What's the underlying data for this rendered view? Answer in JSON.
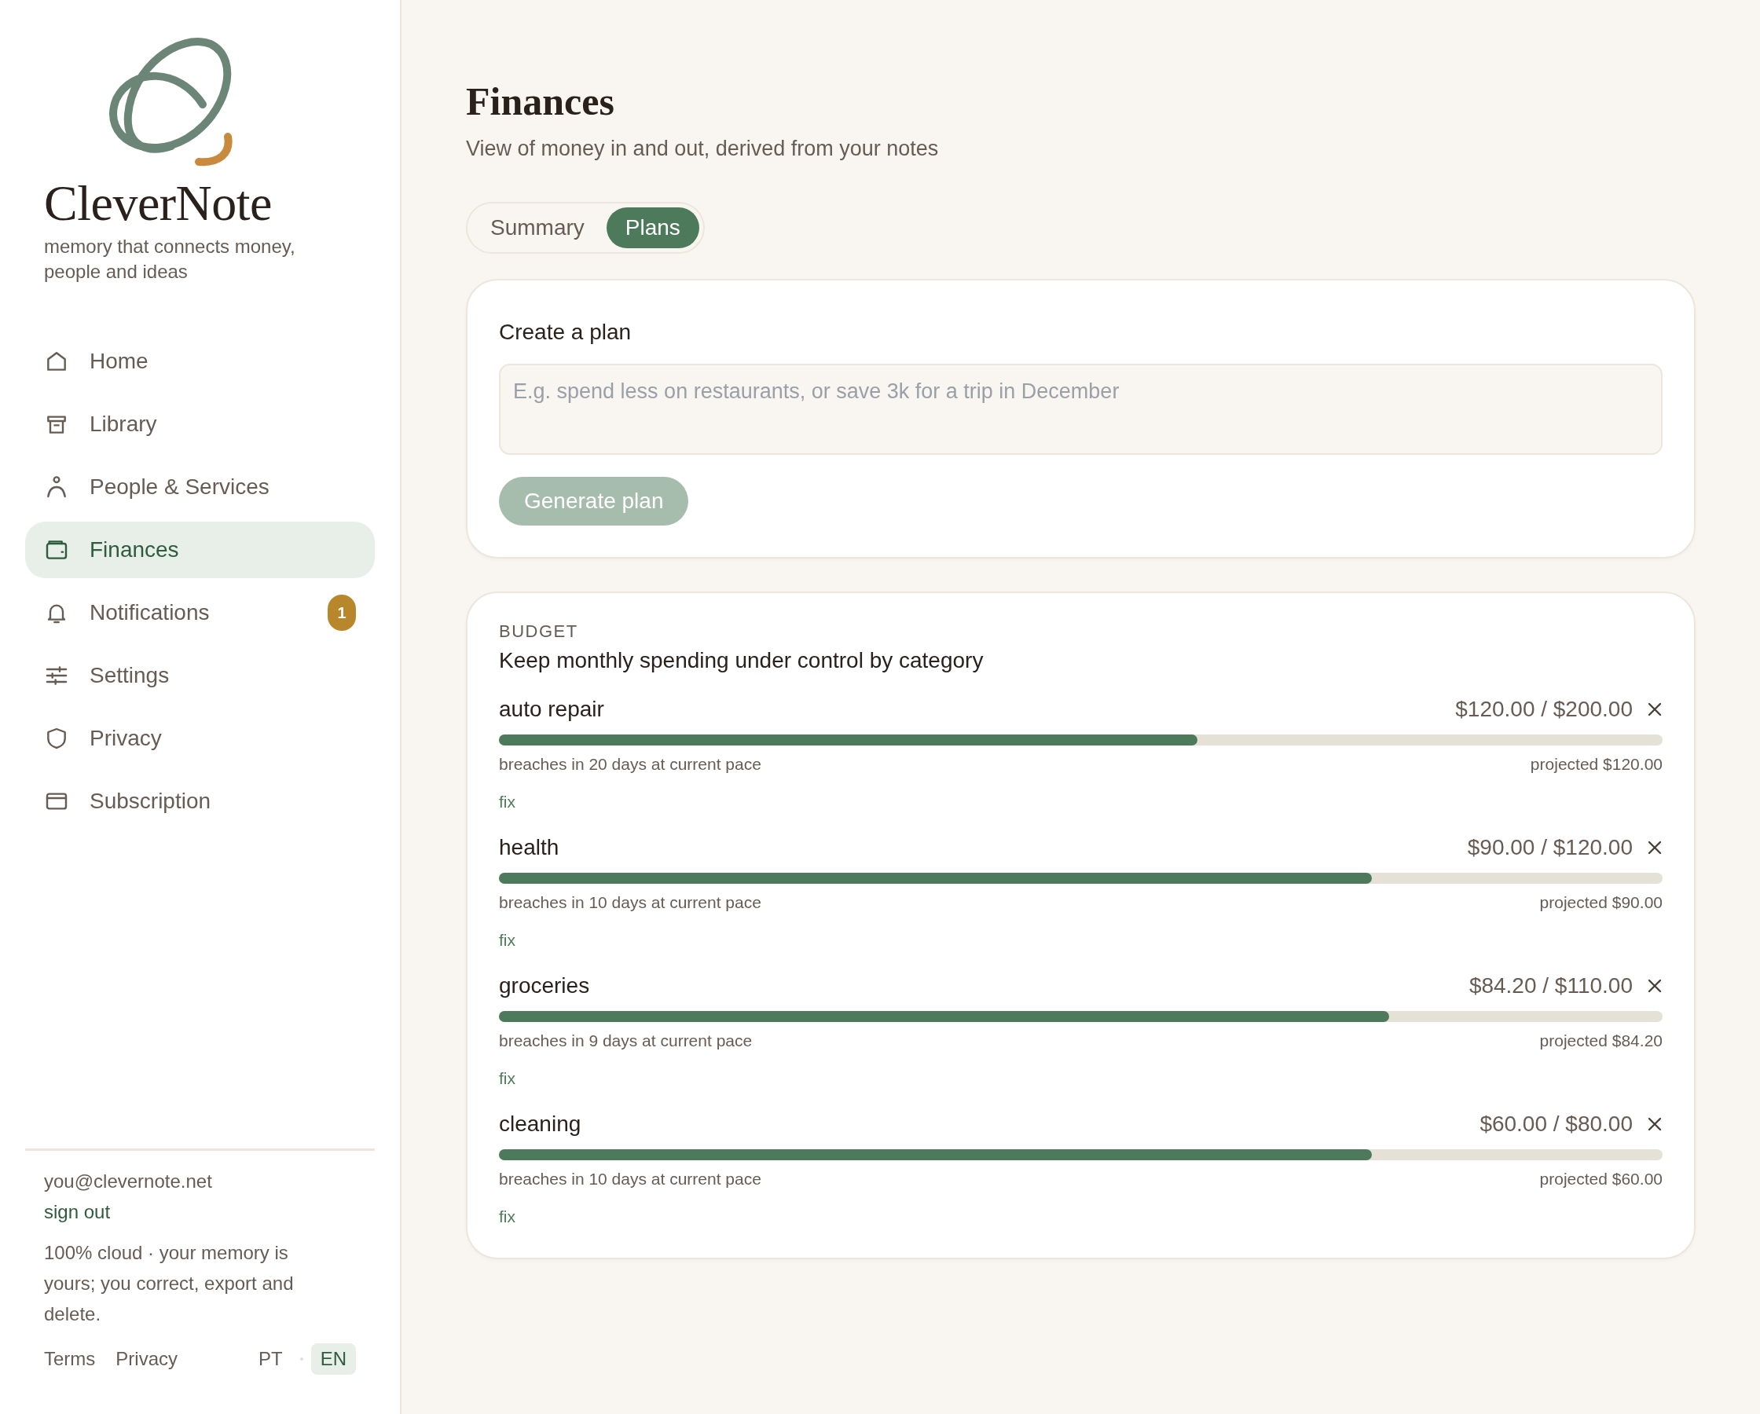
{
  "sidebar": {
    "brand": "CleverNote",
    "tagline": "memory that connects money, people and ideas",
    "items": [
      {
        "label": "Home",
        "kind": "home",
        "selected": false
      },
      {
        "label": "Library",
        "kind": "archive",
        "selected": false
      },
      {
        "label": "People & Services",
        "kind": "person",
        "selected": false
      },
      {
        "label": "Finances",
        "kind": "wallet",
        "selected": true
      },
      {
        "label": "Notifications",
        "kind": "bell",
        "selected": false,
        "badge": "1"
      },
      {
        "label": "Settings",
        "kind": "sliders",
        "selected": false
      },
      {
        "label": "Privacy",
        "kind": "shield",
        "selected": false
      },
      {
        "label": "Subscription",
        "kind": "card",
        "selected": false
      }
    ],
    "email": "you@clevernote.net",
    "sign_out": "sign out",
    "note": "100% cloud · your memory is yours; you correct, export and delete.",
    "links": [
      "Terms",
      "Privacy"
    ],
    "languages": [
      {
        "label": "PT",
        "selected": false
      },
      {
        "label": "EN",
        "selected": true
      }
    ]
  },
  "page": {
    "title": "Finances",
    "subtitle": "View of money in and out, derived from your notes"
  },
  "tabs": [
    {
      "label": "Summary",
      "selected": false
    },
    {
      "label": "Plans",
      "selected": true
    }
  ],
  "create_plan": {
    "title": "Create a plan",
    "placeholder": "E.g. spend less on restaurants, or save 3k for a trip in December",
    "button": "Generate plan",
    "button_disabled": true
  },
  "budget": {
    "kicker": "BUDGET",
    "title": "Keep monthly spending under control by category",
    "rows": [
      {
        "name": "auto repair",
        "amount": "$120.00 / $200.00",
        "level": 0.6,
        "forecast": "breaches in 20 days at current pace",
        "projected": "projected $120.00",
        "action": "fix"
      },
      {
        "name": "health",
        "amount": "$90.00 / $120.00",
        "level": 0.75,
        "forecast": "breaches in 10 days at current pace",
        "projected": "projected $90.00",
        "action": "fix"
      },
      {
        "name": "groceries",
        "amount": "$84.20 / $110.00",
        "level": 0.765,
        "forecast": "breaches in 9 days at current pace",
        "projected": "projected $84.20",
        "action": "fix"
      },
      {
        "name": "cleaning",
        "amount": "$60.00 / $80.00",
        "level": 0.75,
        "forecast": "breaches in 10 days at current pace",
        "projected": "projected $60.00",
        "action": "fix"
      }
    ]
  }
}
